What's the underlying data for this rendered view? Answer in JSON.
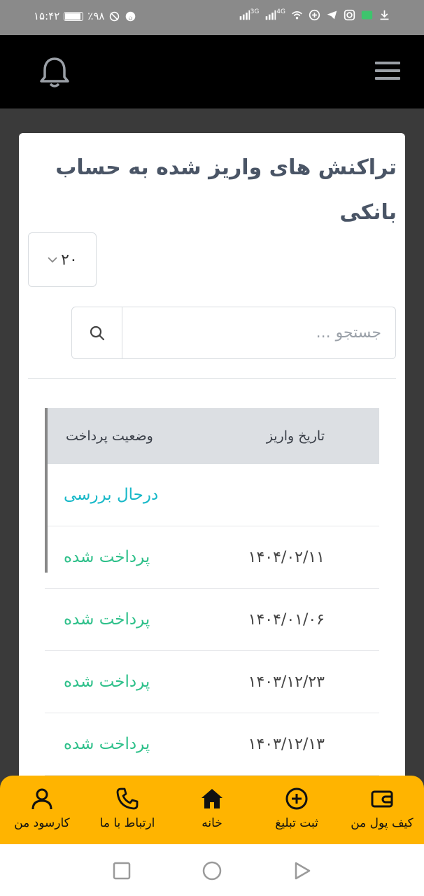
{
  "status_bar": {
    "time": "۱۵:۴۲",
    "battery_percent": "٪۹۸",
    "battery_level": 0.98,
    "network_4g": "4G",
    "network_3g": "3G",
    "icons": [
      "download-icon",
      "app-notification-icon",
      "instagram-icon",
      "telegram-icon",
      "app-icon",
      "wifi-icon",
      "signal-icon"
    ]
  },
  "header": {
    "menu_icon": "hamburger-icon",
    "notification_icon": "bell-icon"
  },
  "page": {
    "title": "تراکنش های واریز شده به حساب بانکی",
    "page_size": "۲۰",
    "search_placeholder": "جستجو ...",
    "search_icon": "search-icon"
  },
  "table": {
    "columns": {
      "deposit_date": "تاریخ واریز",
      "payment_status": "وضعیت پرداخت"
    },
    "rows": [
      {
        "date": "",
        "status": "درحال بررسی",
        "status_color": "#17b8c8"
      },
      {
        "date": "۱۴۰۴/۰۲/۱۱",
        "status": "پرداخت شده",
        "status_color": "#2ec08a"
      },
      {
        "date": "۱۴۰۴/۰۱/۰۶",
        "status": "پرداخت شده",
        "status_color": "#2ec08a"
      },
      {
        "date": "۱۴۰۳/۱۲/۲۳",
        "status": "پرداخت شده",
        "status_color": "#2ec08a"
      },
      {
        "date": "۱۴۰۳/۱۲/۱۳",
        "status": "پرداخت شده",
        "status_color": "#2ec08a"
      }
    ]
  },
  "bottom_nav": {
    "items": [
      {
        "label": "کیف پول من",
        "icon": "wallet-icon"
      },
      {
        "label": "ثبت تبلیغ",
        "icon": "plus-circle-icon"
      },
      {
        "label": "خانه",
        "icon": "home-icon"
      },
      {
        "label": "ارتباط با ما",
        "icon": "phone-icon"
      },
      {
        "label": "کارسود من",
        "icon": "user-icon"
      }
    ]
  },
  "colors": {
    "header_bg": "#000000",
    "nav_bg": "#ffb400",
    "status_pending": "#17b8c8",
    "status_paid": "#2ec08a"
  }
}
